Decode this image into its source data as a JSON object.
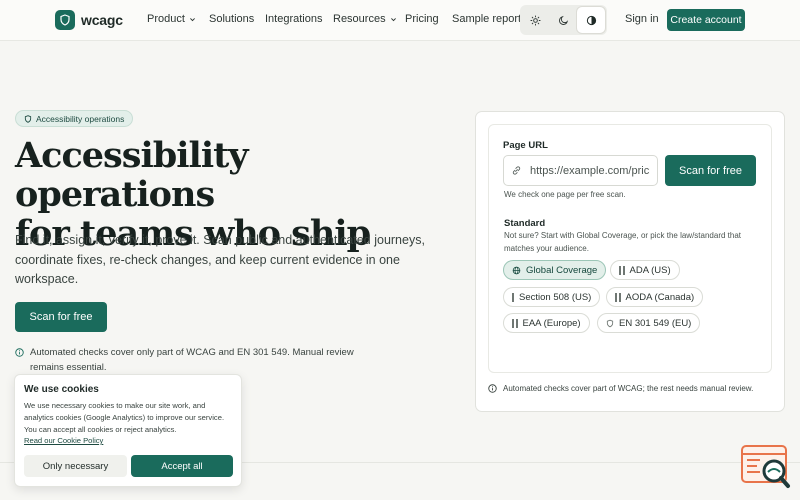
{
  "colors": {
    "brand": "#1a6b5c",
    "background": "#f6f6f3",
    "chip_selected": "#e3efea",
    "widget_accent": "#e8744a"
  },
  "nav": {
    "logo": "wcagc",
    "items": [
      {
        "label": "Product",
        "has_menu": true
      },
      {
        "label": "Solutions",
        "has_menu": false
      },
      {
        "label": "Integrations",
        "has_menu": false
      },
      {
        "label": "Resources",
        "has_menu": true
      },
      {
        "label": "Pricing",
        "has_menu": false
      },
      {
        "label": "Sample report",
        "has_menu": false
      }
    ],
    "theme_options": [
      "sun-icon",
      "moon-icon",
      "contrast-icon"
    ],
    "theme_selected": "contrast",
    "sign_in": "Sign in",
    "create_account": "Create account"
  },
  "hero": {
    "badge": "Accessibility operations",
    "title_line1": "Accessibility operations",
    "title_line2": "for teams who ship",
    "subtitle": "Find it, assign it, verify it, prove it. Scan public and authenticated journeys, coordinate fixes, re-check changes, and keep current evidence in one workspace.",
    "cta": "Scan for free",
    "note": "Automated checks cover only part of WCAG and EN 301 549. Manual review remains essential."
  },
  "scan": {
    "url_label": "Page URL",
    "url_placeholder": "https://example.com/pricing",
    "scan_button": "Scan for free",
    "url_hint": "We check one page per free scan.",
    "standard_label": "Standard",
    "standard_hint": "Not sure? Start with Global Coverage, or pick the law/standard that matches your audience.",
    "standards": [
      {
        "label": "Global Coverage",
        "icon": "globe-icon",
        "selected": true
      },
      {
        "label": "ADA (US)",
        "icon": "bars-icon",
        "selected": false
      },
      {
        "label": "Section 508 (US)",
        "icon": "bar-icon",
        "selected": false
      },
      {
        "label": "AODA (Canada)",
        "icon": "bars-icon",
        "selected": false
      },
      {
        "label": "EAA (Europe)",
        "icon": "bars-icon",
        "selected": false
      },
      {
        "label": "EN 301 549 (EU)",
        "icon": "shield-icon",
        "selected": false
      }
    ],
    "footer_note": "Automated checks cover part of WCAG; the rest needs manual review."
  },
  "cookie": {
    "title": "We use cookies",
    "text": "We use necessary cookies to make our site work, and analytics cookies (Google Analytics) to improve our service. You can accept all cookies or reject analytics.",
    "link": "Read our Cookie Policy",
    "reject": "Only necessary",
    "accept": "Accept all"
  }
}
